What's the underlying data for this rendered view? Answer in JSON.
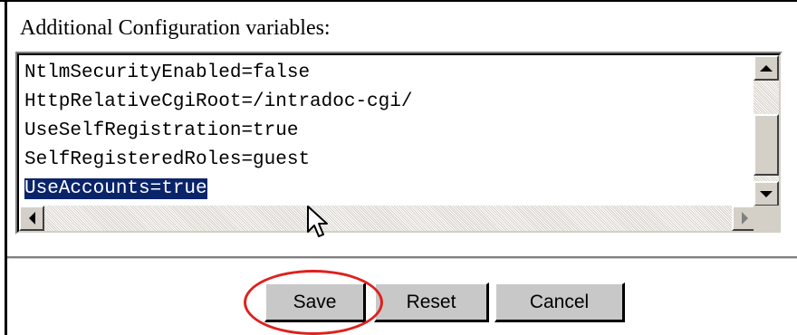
{
  "section": {
    "label": "Additional Configuration variables:"
  },
  "config_lines": [
    {
      "text": "NtlmSecurityEnabled=false",
      "selected": false
    },
    {
      "text": "HttpRelativeCgiRoot=/intradoc-cgi/",
      "selected": false
    },
    {
      "text": "UseSelfRegistration=true",
      "selected": false
    },
    {
      "text": "SelfRegisteredRoles=guest",
      "selected": false
    },
    {
      "text": "UseAccounts=true",
      "selected": true
    }
  ],
  "buttons": {
    "save": "Save",
    "reset": "Reset",
    "cancel": "Cancel"
  },
  "colors": {
    "selection": "#0a246a",
    "highlight_ellipse": "#e0201c",
    "button_face": "#c8c8c8"
  },
  "icons": {
    "scroll_up": "arrow-up-icon",
    "scroll_down": "arrow-down-icon",
    "scroll_left": "arrow-left-icon",
    "scroll_right": "arrow-right-icon",
    "cursor": "mouse-pointer-icon"
  }
}
